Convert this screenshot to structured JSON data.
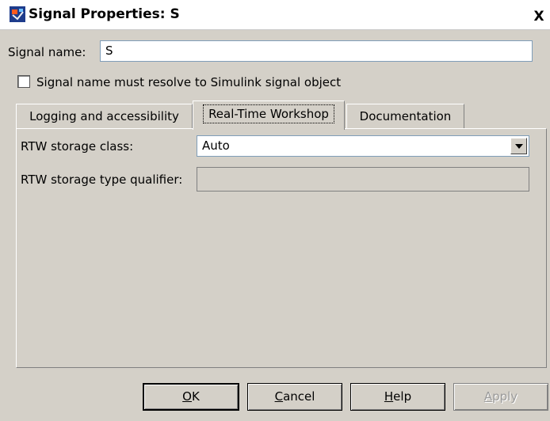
{
  "window": {
    "title": "Signal Properties: S",
    "close_symbol": "X",
    "icon": "simulink-app-icon"
  },
  "signal_name": {
    "label": "Signal name:",
    "value": "S"
  },
  "resolve_checkbox": {
    "label": "Signal name must resolve to Simulink signal object",
    "checked": false
  },
  "tabs": [
    {
      "label": "Logging and accessibility",
      "active": false
    },
    {
      "label": "Real-Time Workshop",
      "active": true
    },
    {
      "label": "Documentation",
      "active": false
    }
  ],
  "rtw": {
    "storage_class_label": "RTW storage class:",
    "storage_class_value": "Auto",
    "type_qualifier_label": "RTW storage type qualifier:",
    "type_qualifier_value": ""
  },
  "buttons": {
    "ok": {
      "prefix": "",
      "mnemonic": "O",
      "suffix": "K"
    },
    "cancel": {
      "prefix": "",
      "mnemonic": "C",
      "suffix": "ancel"
    },
    "help": {
      "prefix": "",
      "mnemonic": "H",
      "suffix": "elp"
    },
    "apply": {
      "prefix": "",
      "mnemonic": "A",
      "suffix": "pply",
      "disabled": true
    }
  }
}
